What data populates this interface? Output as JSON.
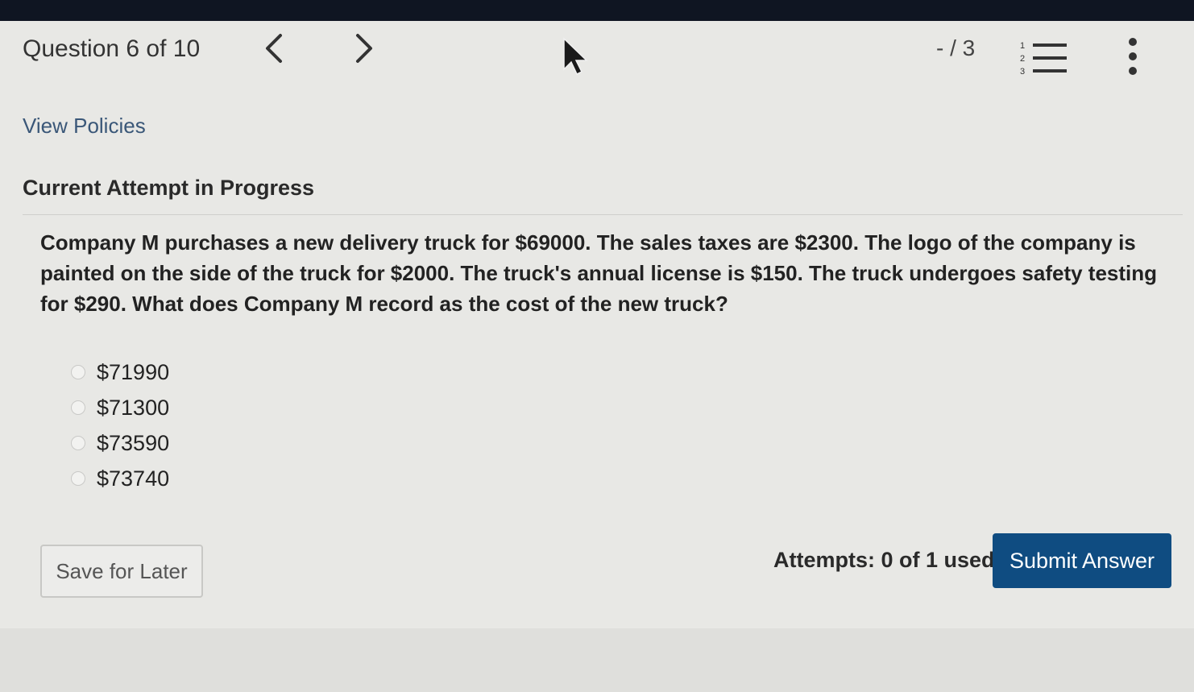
{
  "header": {
    "question_label": "Question 6 of 10",
    "score": "- / 3"
  },
  "links": {
    "view_policies": "View Policies"
  },
  "attempt": {
    "title": "Current Attempt in Progress"
  },
  "question": {
    "text": "Company M purchases a new delivery truck for $69000. The sales taxes are $2300. The logo of the company is painted on the side of the truck for $2000. The truck's annual license is $150. The truck undergoes safety testing for $290. What does Company M record as the cost of the new truck?",
    "options": [
      "$71990",
      "$71300",
      "$73590",
      "$73740"
    ]
  },
  "footer": {
    "save_label": "Save for Later",
    "attempts_text": "Attempts: 0 of 1 used",
    "submit_label": "Submit Answer"
  },
  "icons": {
    "prev": "chevron-left-icon",
    "next": "chevron-right-icon",
    "list": "numbered-list-icon",
    "more": "more-vertical-icon"
  },
  "colors": {
    "accent": "#0f4c81",
    "link": "#3a5778",
    "topbar": "#0f1522"
  }
}
